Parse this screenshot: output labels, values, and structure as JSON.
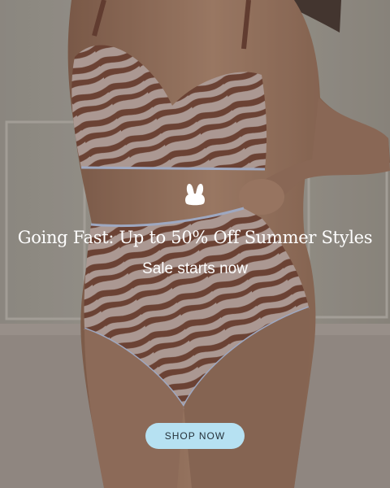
{
  "promo": {
    "headline": "Going Fast: Up to 50% Off Summer Styles",
    "subheadline": "Sale starts now",
    "cta_label": "SHOP NOW"
  },
  "colors": {
    "cta_background": "#b6e1f2",
    "text": "#ffffff"
  },
  "icons": {
    "logo": "bunny-logo-icon"
  }
}
